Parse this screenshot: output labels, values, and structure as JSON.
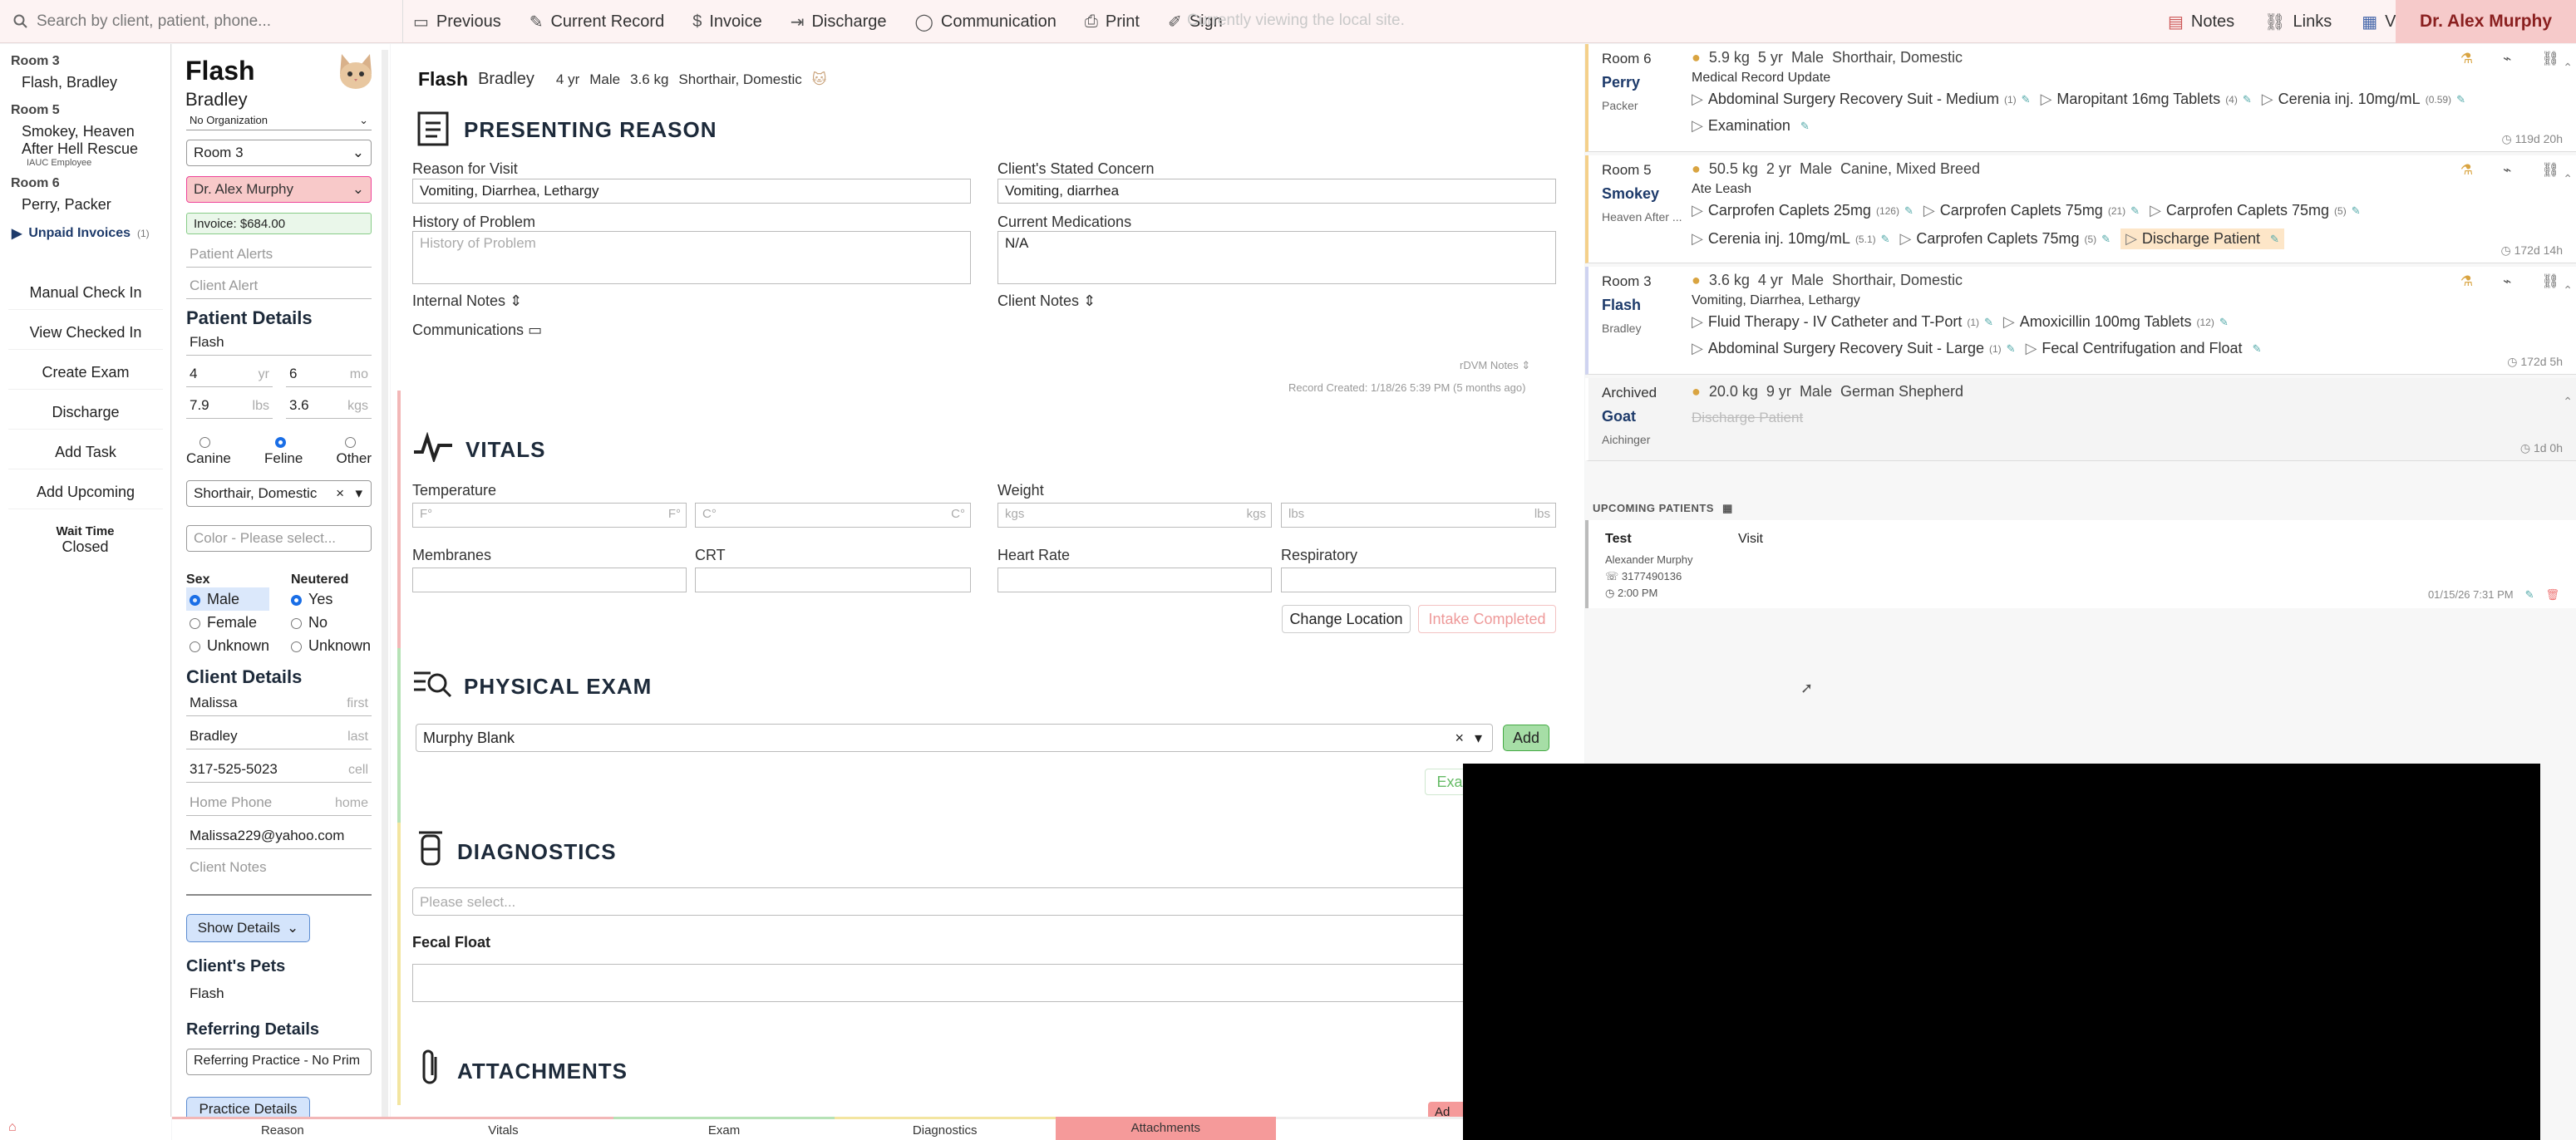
{
  "topbar": {
    "search_placeholder": "Search by client, patient, phone...",
    "actions": [
      "Previous",
      "Current Record",
      "Invoice",
      "Discharge",
      "Communication",
      "Print",
      "Sign"
    ],
    "local_notice": "Currently viewing the local site.",
    "right_links": [
      "Notes",
      "Links",
      "Visits"
    ],
    "doctor": "Dr. Alex Murphy"
  },
  "rooms": [
    {
      "room": "Room 3",
      "patients": [
        "Flash, Bradley"
      ]
    },
    {
      "room": "Room 5",
      "patients": [
        "Smokey, Heaven After Hell Rescue"
      ],
      "note": "IAUC Employee"
    },
    {
      "room": "Room 6",
      "patients": [
        "Perry, Packer"
      ]
    }
  ],
  "unpaid": {
    "label": "Unpaid Invoices",
    "count": "(1)"
  },
  "nav_buttons": [
    "Manual Check In",
    "View Checked In",
    "Create Exam",
    "Discharge",
    "Add Task",
    "Add Upcoming"
  ],
  "wait": {
    "label": "Wait Time",
    "value": "Closed"
  },
  "patient": {
    "name": "Flash",
    "owner": "Bradley",
    "org": "No Organization",
    "room": "Room 3",
    "doctor": "Dr. Alex Murphy",
    "invoice": "Invoice: $684.00",
    "alerts_placeholder": "Patient Alerts",
    "client_alert_placeholder": "Client Alert",
    "details_title": "Patient Details",
    "pet_name": "Flash",
    "age_yr": "4",
    "age_mo": "6",
    "weight_lbs": "7.9",
    "weight_kgs": "3.6",
    "units": {
      "yr": "yr",
      "mo": "mo",
      "lbs": "lbs",
      "kgs": "kgs"
    },
    "species": [
      "Canine",
      "Feline",
      "Other"
    ],
    "species_selected": "Feline",
    "breed": "Shorthair, Domestic",
    "color_placeholder": "Color - Please select...",
    "sex_label": "Sex",
    "sex_options": [
      "Male",
      "Female",
      "Unknown"
    ],
    "neutered_label": "Neutered",
    "neutered_options": [
      "Yes",
      "No",
      "Unknown"
    ]
  },
  "client": {
    "title": "Client Details",
    "first": "Malissa",
    "first_unit": "first",
    "last": "Bradley",
    "last_unit": "last",
    "cell": "317-525-5023",
    "cell_unit": "cell",
    "home_placeholder": "Home Phone",
    "home_unit": "home",
    "email": "Malissa229@yahoo.com",
    "notes_placeholder": "Client Notes",
    "show_details": "Show Details",
    "pets_title": "Client's Pets",
    "pets": [
      "Flash"
    ],
    "ref_title": "Referring Details",
    "ref_value": "Referring Practice - No Prim",
    "practice_btn": "Practice Details"
  },
  "main": {
    "header": {
      "name": "Flash",
      "owner": "Bradley",
      "age": "4 yr",
      "sex": "Male",
      "weight": "3.6 kg",
      "breed": "Shorthair, Domestic"
    },
    "presenting": {
      "title": "PRESENTING REASON",
      "reason_label": "Reason for Visit",
      "reason": "Vomiting, Diarrhea, Lethargy",
      "concern_label": "Client's Stated Concern",
      "concern": "Vomiting, diarrhea",
      "history_label": "History of Problem",
      "history_placeholder": "History of Problem",
      "meds_label": "Current Medications",
      "meds": "N/A",
      "internal_notes": "Internal Notes",
      "client_notes": "Client Notes",
      "communications": "Communications",
      "rdvm": "rDVM Notes",
      "created": "Record Created: 1/18/26 5:39 PM (5 months ago)"
    },
    "vitals": {
      "title": "VITALS",
      "temp_label": "Temperature",
      "f_ph": "F°",
      "c_ph": "C°",
      "weight_label": "Weight",
      "kgs_ph": "kgs",
      "lbs_ph": "lbs",
      "membranes": "Membranes",
      "crt": "CRT",
      "hr": "Heart Rate",
      "resp": "Respiratory",
      "change_location": "Change Location",
      "intake": "Intake Completed"
    },
    "exam": {
      "title": "PHYSICAL EXAM",
      "template": "Murphy Blank",
      "add": "Add",
      "exam_btn": "Exa"
    },
    "diagnostics": {
      "title": "DIAGNOSTICS",
      "select_placeholder": "Please select...",
      "test": "Fecal Float"
    },
    "attachments": {
      "title": "ATTACHMENTS",
      "add": "Ad"
    }
  },
  "visits": [
    {
      "room": "Room 6",
      "name": "Perry",
      "owner": "Packer",
      "weight": "5.9 kg",
      "age": "5 yr",
      "sex": "Male",
      "breed": "Shorthair, Domestic",
      "reason": "Medical Record Update",
      "ago": "119d 20h",
      "rows": [
        [
          {
            "t": "Abdominal Surgery Recovery Suit - Medium",
            "q": "(1)"
          },
          {
            "t": "Maropitant 16mg Tablets",
            "q": "(4)"
          },
          {
            "t": "Cerenia inj. 10mg/mL",
            "q": "(0.59)"
          }
        ],
        [
          {
            "t": "Examination",
            "q": ""
          }
        ]
      ]
    },
    {
      "room": "Room 5",
      "name": "Smokey",
      "owner": "Heaven After ...",
      "weight": "50.5 kg",
      "age": "2 yr",
      "sex": "Male",
      "breed": "Canine, Mixed Breed",
      "reason": "Ate Leash",
      "ago": "172d 14h",
      "rows": [
        [
          {
            "t": "Carprofen Caplets 25mg",
            "q": "(126)"
          },
          {
            "t": "Carprofen Caplets 75mg",
            "q": "(21)"
          },
          {
            "t": "Carprofen Caplets 75mg",
            "q": "(5)"
          }
        ],
        [
          {
            "t": "Cerenia inj. 10mg/mL",
            "q": "(5.1)"
          },
          {
            "t": "Carprofen Caplets 75mg",
            "q": "(5)"
          },
          {
            "t": "Discharge Patient",
            "q": "",
            "hl": true
          }
        ]
      ]
    },
    {
      "room": "Room 3",
      "name": "Flash",
      "owner": "Bradley",
      "weight": "3.6 kg",
      "age": "4 yr",
      "sex": "Male",
      "breed": "Shorthair, Domestic",
      "reason": "Vomiting, Diarrhea, Lethargy",
      "ago": "172d 5h",
      "rows": [
        [
          {
            "t": "Fluid Therapy - IV Catheter and T-Port",
            "q": "(1)"
          },
          {
            "t": "Amoxicillin 100mg Tablets",
            "q": "(12)"
          }
        ],
        [
          {
            "t": "Abdominal Surgery Recovery Suit - Large",
            "q": "(1)"
          },
          {
            "t": "Fecal Centrifugation and Float",
            "q": ""
          }
        ]
      ]
    },
    {
      "room": "Archived",
      "name": "Goat",
      "owner": "Aichinger",
      "weight": "20.0 kg",
      "age": "9 yr",
      "sex": "Male",
      "breed": "German Shepherd",
      "reason": "Discharge Patient",
      "ago": "1d 0h",
      "rows": []
    }
  ],
  "upcoming": {
    "title": "UPCOMING PATIENTS",
    "name": "Test",
    "type": "Visit",
    "doctor": "Alexander Murphy",
    "phone": "3177490136",
    "time": "2:00 PM",
    "created": "01/15/26 7:31 PM"
  },
  "tabs": [
    "Reason",
    "Vitals",
    "Exam",
    "Diagnostics",
    "Attachments"
  ],
  "colors": {
    "accent_red": "#f6caca",
    "active_tab": "#f59a9a",
    "link_blue": "#1d3a6a"
  }
}
